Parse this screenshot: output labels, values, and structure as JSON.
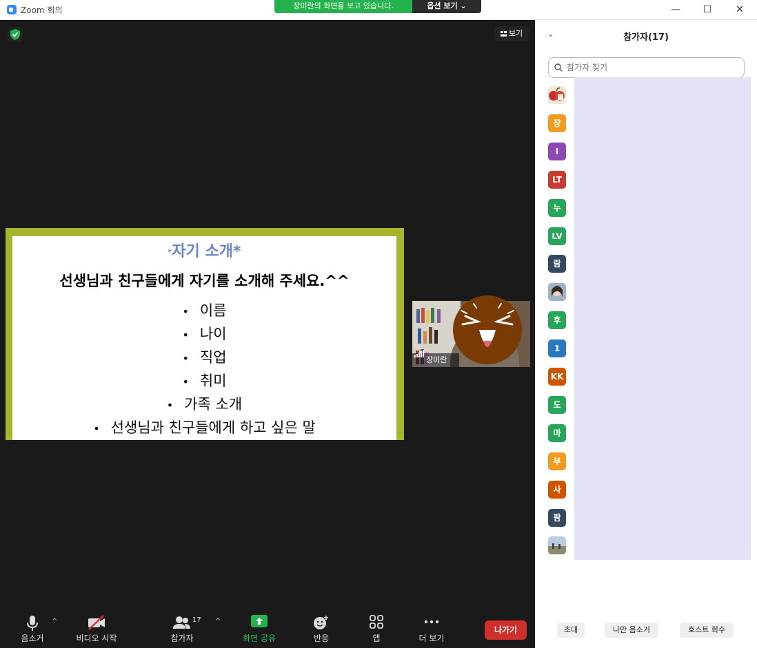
{
  "window": {
    "title": "Zoom 회의",
    "share_banner": "장미란의 화면을 보고 있습니다.",
    "share_options": "옵션 보기 ⌄"
  },
  "meeting": {
    "view_label": "보기",
    "slide": {
      "title_prefix": "*",
      "title": "자기 소개*",
      "subtitle": "선생님과 친구들에게 자기를 소개해 주세요.^^",
      "bullets": [
        "이름",
        "나이",
        "직업",
        "취미",
        "가족 소개",
        "선생님과 친구들에게 하고 싶은 말"
      ]
    },
    "camera_name": "장미란"
  },
  "toolbar": {
    "mute": "음소거",
    "video": "비디오 시작",
    "participants": "참가자",
    "participants_count": "17",
    "share": "화면 공유",
    "reactions": "반응",
    "apps": "앱",
    "more": "더 보기",
    "leave": "나가기"
  },
  "panel": {
    "title": "참가자(17)",
    "search_placeholder": "참가자 찾기",
    "avatars": [
      {
        "type": "image",
        "icon": "apple-avatar-image"
      },
      {
        "label": "장",
        "color": "#f29b1e"
      },
      {
        "label": "I",
        "color": "#8e47b5"
      },
      {
        "label": "LT",
        "color": "#c93a31"
      },
      {
        "label": "누",
        "color": "#27a55a"
      },
      {
        "label": "LV",
        "color": "#27a55a"
      },
      {
        "label": "람",
        "color": "#34495e"
      },
      {
        "type": "image",
        "icon": "person-avatar-image"
      },
      {
        "label": "후",
        "color": "#27a55a"
      },
      {
        "label": "1",
        "color": "#2978c2"
      },
      {
        "label": "KK",
        "color": "#d35400"
      },
      {
        "label": "도",
        "color": "#27a55a"
      },
      {
        "label": "마",
        "color": "#27a55a"
      },
      {
        "label": "부",
        "color": "#f29b1e"
      },
      {
        "label": "사",
        "color": "#d35400"
      },
      {
        "label": "팜",
        "color": "#34495e"
      },
      {
        "type": "image",
        "icon": "landscape-avatar-image"
      }
    ],
    "invite": "초대",
    "mute_me": "나만 음소거",
    "reclaim_host": "호스트 회수"
  }
}
